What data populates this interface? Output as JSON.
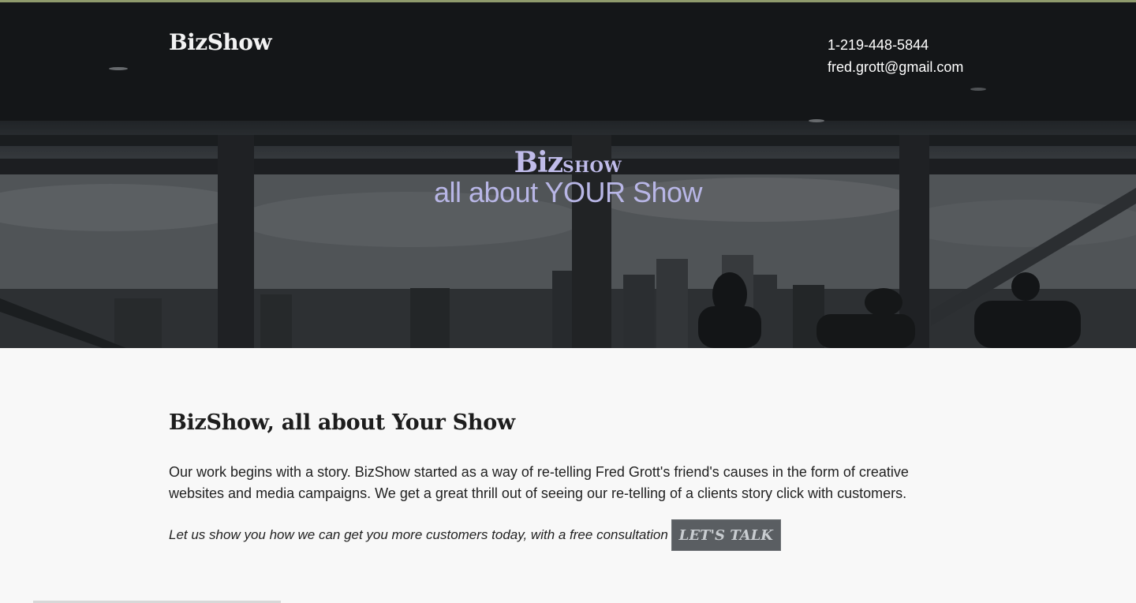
{
  "header": {
    "brand": "BizShow",
    "phone": "1-219-448-5844",
    "email": "fred.grott@gmail.com"
  },
  "hero": {
    "logo_big": "Biz",
    "logo_small": "SHOW",
    "tagline": "all about YOUR Show"
  },
  "main": {
    "heading": "BizShow, all about Your Show",
    "paragraph": "Our work begins with a story. BizShow started as a way of re-telling Fred Grott's friend's causes in the form of creative websites and media campaigns. We get a great thrill out of seeing our re-telling of a clients story click with customers.",
    "cta_text": "Let us show you how we can get you more customers today, with a free consultation",
    "cta_button": "LET'S TALK"
  },
  "colors": {
    "hero_text": "#bfbbe9",
    "button_bg": "#5a5e62",
    "top_strip": "#8f9a6c"
  }
}
